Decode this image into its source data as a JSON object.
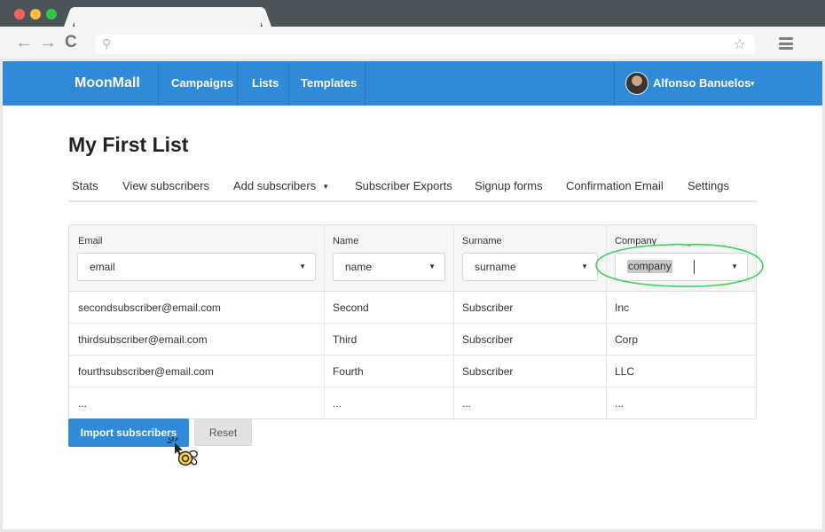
{
  "browser": {
    "window_controls": [
      "close",
      "minimize",
      "maximize"
    ],
    "nav_icons": {
      "back": "arrow-left-icon",
      "forward": "arrow-right-icon",
      "reload": "reload-icon"
    },
    "url_icon": "search-icon",
    "bookmark_icon": "star-icon",
    "menu_icon": "hamburger-menu-icon"
  },
  "app": {
    "brand": "MoonMall",
    "nav": {
      "campaigns": "Campaigns",
      "lists": "Lists",
      "templates": "Templates"
    },
    "user": {
      "name": "Alfonso Banuelos",
      "caret": "▾"
    },
    "accent_color": "#2f8ad8"
  },
  "page": {
    "title": "My First List",
    "subnav": {
      "stats": "Stats",
      "view_subscribers": "View subscribers",
      "add_subscribers": "Add subscribers",
      "add_caret": "▼",
      "exports": "Subscriber Exports",
      "signup_forms": "Signup forms",
      "confirmation_email": "Confirmation Email",
      "settings": "Settings"
    }
  },
  "table": {
    "columns": [
      {
        "label": "Email",
        "selected": "email"
      },
      {
        "label": "Name",
        "selected": "name"
      },
      {
        "label": "Surname",
        "selected": "surname"
      },
      {
        "label": "Company",
        "selected": "company"
      }
    ],
    "select_arrow": "▼",
    "rows": [
      [
        "secondsubscriber@email.com",
        "Second",
        "Subscriber",
        "Inc"
      ],
      [
        "thirdsubscriber@email.com",
        "Third",
        "Subscriber",
        "Corp"
      ],
      [
        "fourthsubscriber@email.com",
        "Fourth",
        "Subscriber",
        "LLC"
      ],
      [
        "...",
        "...",
        "...",
        "..."
      ]
    ]
  },
  "actions": {
    "import": "Import subscribers",
    "reset": "Reset"
  },
  "annotation": {
    "highlight_color": "#3dd15a"
  }
}
